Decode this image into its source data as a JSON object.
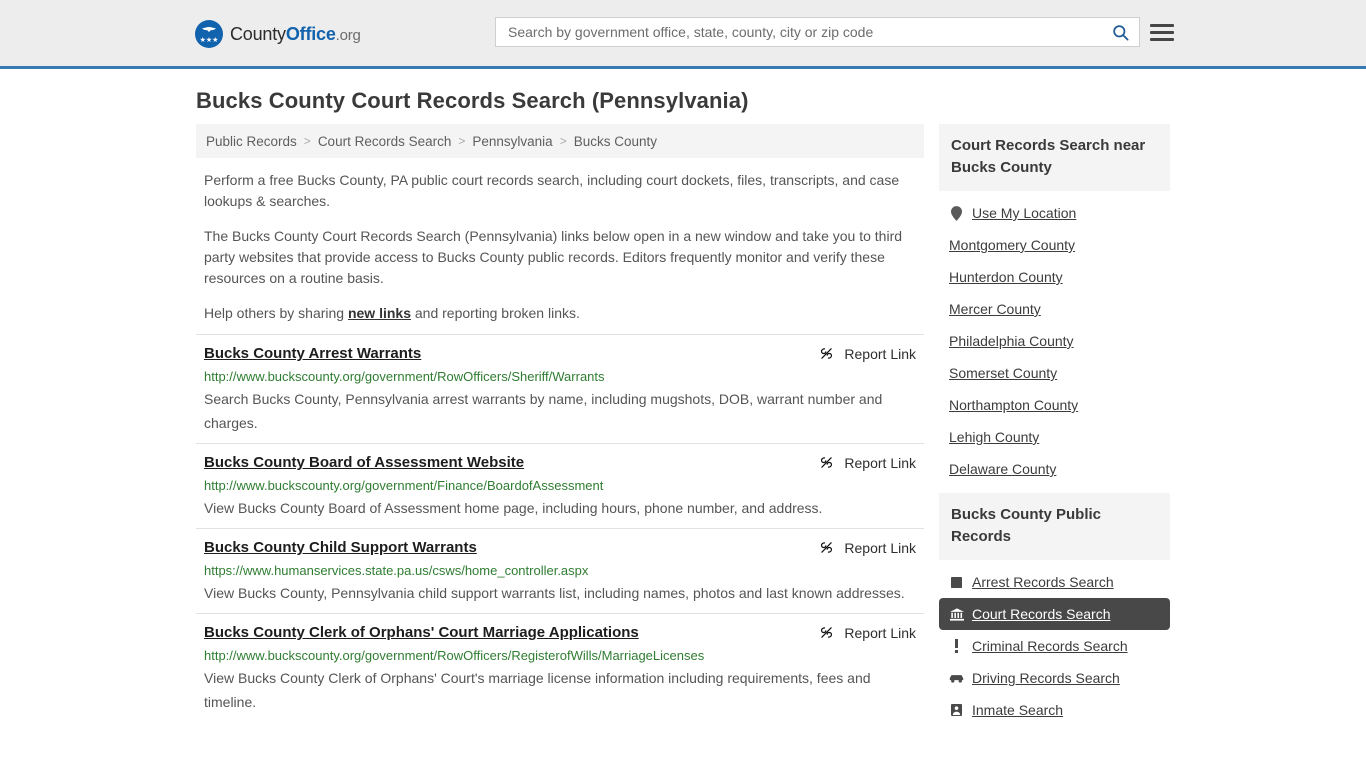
{
  "header": {
    "brand": {
      "part1": "County",
      "part2": "Office",
      "part3": ".org"
    },
    "search": {
      "placeholder": "Search by government office, state, county, city or zip code",
      "value": "",
      "icon": "search-icon"
    },
    "menu_icon": "hamburger-menu-icon",
    "accent_color": "#3a7ab3"
  },
  "page": {
    "title": "Bucks County Court Records Search (Pennsylvania)"
  },
  "breadcrumb": {
    "separator": ">",
    "items": [
      {
        "label": "Public Records"
      },
      {
        "label": "Court Records Search"
      },
      {
        "label": "Pennsylvania"
      },
      {
        "label": "Bucks County"
      }
    ]
  },
  "intro": {
    "p1": "Perform a free Bucks County, PA public court records search, including court dockets, files, transcripts, and case lookups & searches.",
    "p2": "The Bucks County Court Records Search (Pennsylvania) links below open in a new window and take you to third party websites that provide access to Bucks County public records. Editors frequently monitor and verify these resources on a routine basis.",
    "p3_before": "Help others by sharing ",
    "p3_link": "new links",
    "p3_after": " and reporting broken links."
  },
  "report_link_label": "Report Link",
  "listings": [
    {
      "title": "Bucks County Arrest Warrants",
      "url": "http://www.buckscounty.org/government/RowOfficers/Sheriff/Warrants",
      "description": "Search Bucks County, Pennsylvania arrest warrants by name, including mugshots, DOB, warrant number and charges."
    },
    {
      "title": "Bucks County Board of Assessment Website",
      "url": "http://www.buckscounty.org/government/Finance/BoardofAssessment",
      "description": "View Bucks County Board of Assessment home page, including hours, phone number, and address."
    },
    {
      "title": "Bucks County Child Support Warrants",
      "url": "https://www.humanservices.state.pa.us/csws/home_controller.aspx",
      "description": "View Bucks County, Pennsylvania child support warrants list, including names, photos and last known addresses."
    },
    {
      "title": "Bucks County Clerk of Orphans' Court Marriage Applications",
      "url": "http://www.buckscounty.org/government/RowOfficers/RegisterofWills/MarriageLicenses",
      "description": "View Bucks County Clerk of Orphans' Court's marriage license information including requirements, fees and timeline."
    }
  ],
  "sidebar": {
    "nearby": {
      "heading": "Court Records Search near Bucks County",
      "items": [
        {
          "label": "Use My Location",
          "icon": "map-pin-icon",
          "active": false
        },
        {
          "label": "Montgomery County",
          "icon": "",
          "active": false
        },
        {
          "label": "Hunterdon County",
          "icon": "",
          "active": false
        },
        {
          "label": "Mercer County",
          "icon": "",
          "active": false
        },
        {
          "label": "Philadelphia County",
          "icon": "",
          "active": false
        },
        {
          "label": "Somerset County",
          "icon": "",
          "active": false
        },
        {
          "label": "Northampton County",
          "icon": "",
          "active": false
        },
        {
          "label": "Lehigh County",
          "icon": "",
          "active": false
        },
        {
          "label": "Delaware County",
          "icon": "",
          "active": false
        }
      ]
    },
    "public_records": {
      "heading": "Bucks County Public Records",
      "items": [
        {
          "label": "Arrest Records Search",
          "icon": "square-badge-icon",
          "active": false
        },
        {
          "label": "Court Records Search",
          "icon": "courthouse-icon",
          "active": true
        },
        {
          "label": "Criminal Records Search",
          "icon": "exclamation-icon",
          "active": false
        },
        {
          "label": "Driving Records Search",
          "icon": "car-icon",
          "active": false
        },
        {
          "label": "Inmate Search",
          "icon": "inmate-icon",
          "active": false
        }
      ]
    }
  }
}
